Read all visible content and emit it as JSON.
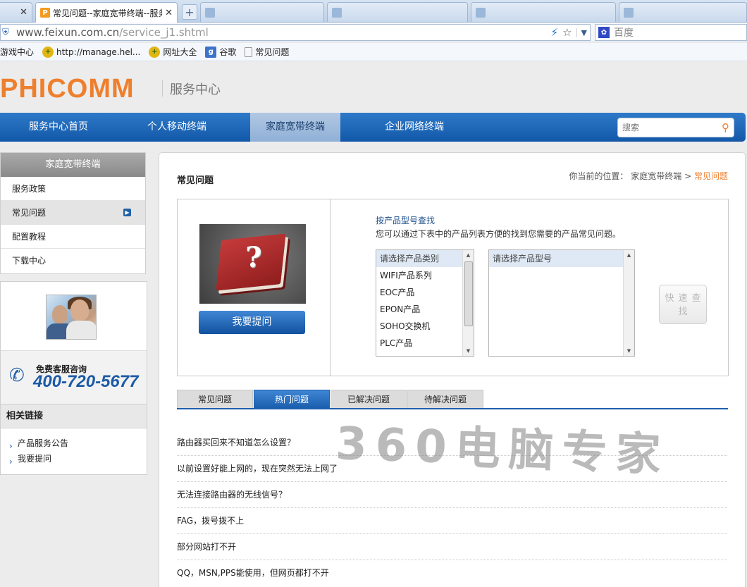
{
  "browser": {
    "tabs": [
      {
        "label": "",
        "state": "inactive"
      },
      {
        "label": "常见问题--家庭宽带终端--服务",
        "state": "active",
        "favicon": "P"
      }
    ],
    "ghost_tabs": 4,
    "new_tab_symbol": "+",
    "close_symbol": "✕",
    "address": {
      "host": "www.feixun.com.cn",
      "path": "/service_j1.shtml"
    },
    "search": {
      "engine_icon": "paw-icon",
      "placeholder": "百度"
    }
  },
  "bookmarks": [
    {
      "label": "游戏中心",
      "icon": ""
    },
    {
      "label": "http://manage.hel...",
      "icon": "plus-circle-icon"
    },
    {
      "label": "网址大全",
      "icon": "plus-circle-icon"
    },
    {
      "label": "谷歌",
      "icon": "google-icon",
      "glyph": "g"
    },
    {
      "label": "常见问题",
      "icon": "page-icon"
    }
  ],
  "site": {
    "logo": "PHICOMM",
    "logo_subtitle": "服务中心",
    "nav": [
      "服务中心首页",
      "个人移动终端",
      "家庭宽带终端",
      "企业网络终端"
    ],
    "nav_active": 2,
    "search_placeholder": "搜索"
  },
  "sidebar": {
    "header": "家庭宽带终端",
    "items": [
      "服务政策",
      "常见问题",
      "配置教程",
      "下载中心"
    ],
    "active": 1,
    "hotline_label": "免费客服咨询",
    "hotline_number": "400-720-5677",
    "related_title": "相关链接",
    "related": [
      "产品服务公告",
      "我要提问"
    ]
  },
  "main": {
    "title": "常见问题",
    "breadcrumb": {
      "prefix": "你当前的位置：",
      "parent": "家庭宽带终端",
      "sep": ">",
      "current": "常见问题"
    },
    "ask_button": "我要提问",
    "finder_title": "按产品型号查找",
    "finder_desc": "您可以通过下表中的产品列表方便的找到您需要的产品常见问题。",
    "category_options": [
      "请选择产品类别",
      "WIFI产品系列",
      "EOC产品",
      "EPON产品",
      "SOHO交换机",
      "PLC产品"
    ],
    "model_options": [
      "请选择产品型号"
    ],
    "quick_button": "快速查找",
    "tabs": [
      "常见问题",
      "热门问题",
      "已解决问题",
      "待解决问题"
    ],
    "active_tab": 1,
    "questions": [
      "路由器买回来不知道怎么设置？",
      "以前设置好能上网的，现在突然无法上网了",
      "无法连接路由器的无线信号？",
      "FAG，拨号拨不上",
      "部分网站打不开",
      "QQ，MSN,PPS能使用，但网页都打不开"
    ]
  },
  "watermark": "360电脑专家",
  "colors": {
    "brand_orange": "#ee7f2d",
    "nav_blue": "#1358a8",
    "link_blue": "#1c4e8c"
  }
}
